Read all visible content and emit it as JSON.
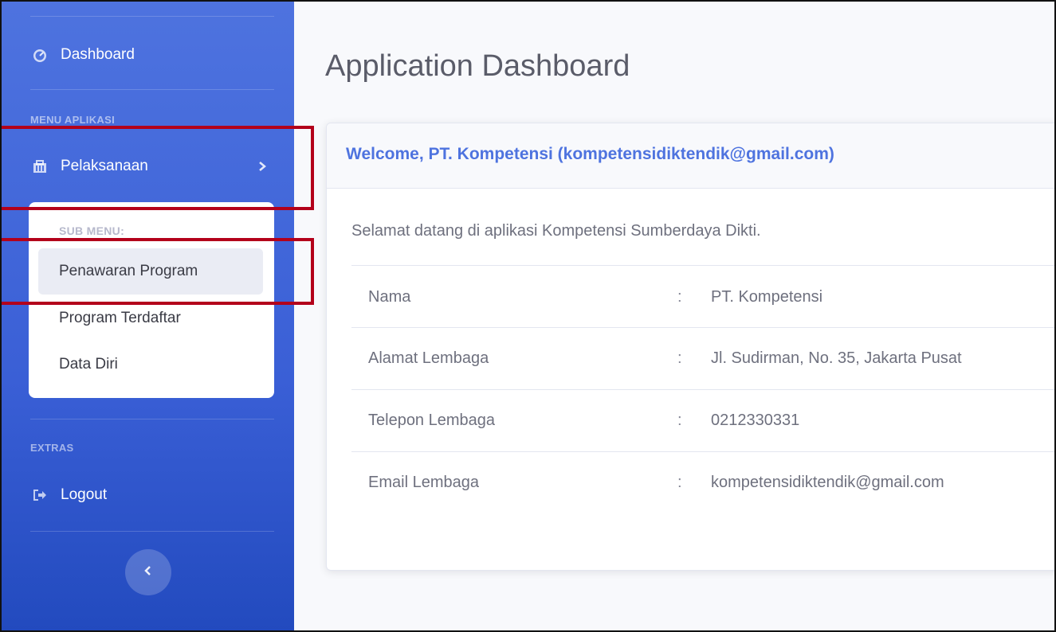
{
  "sidebar": {
    "dashboard_label": "Dashboard",
    "section_menu": "MENU APLIKASI",
    "pelaksanaan_label": "Pelaksanaan",
    "submenu": {
      "heading": "SUB MENU:",
      "items": [
        {
          "label": "Penawaran Program",
          "active": true
        },
        {
          "label": "Program Terdaftar",
          "active": false
        },
        {
          "label": "Data Diri",
          "active": false
        }
      ]
    },
    "section_extras": "EXTRAS",
    "logout_label": "Logout",
    "icons": {
      "dashboard": "tachometer-icon",
      "pelaksanaan": "building-icon",
      "logout": "sign-out-icon",
      "expand": "chevron-right-icon",
      "toggle": "chevron-left-icon"
    }
  },
  "main": {
    "title": "Application Dashboard",
    "card": {
      "welcome": "Welcome, PT. Kompetensi (kompetensidiktendik@gmail.com)",
      "greeting": "Selamat datang di aplikasi Kompetensi Sumberdaya Dikti.",
      "rows": [
        {
          "label": "Nama",
          "separator": ":",
          "value": "PT. Kompetensi"
        },
        {
          "label": "Alamat Lembaga",
          "separator": ":",
          "value": "Jl. Sudirman, No. 35, Jakarta Pusat"
        },
        {
          "label": "Telepon Lembaga",
          "separator": ":",
          "value": "0212330331"
        },
        {
          "label": "Email Lembaga",
          "separator": ":",
          "value": "kompetensidiktendik@gmail.com"
        }
      ]
    }
  },
  "colors": {
    "primary": "#4e73df",
    "highlight_box": "#b3001b",
    "text_gray": "#6e707e"
  }
}
